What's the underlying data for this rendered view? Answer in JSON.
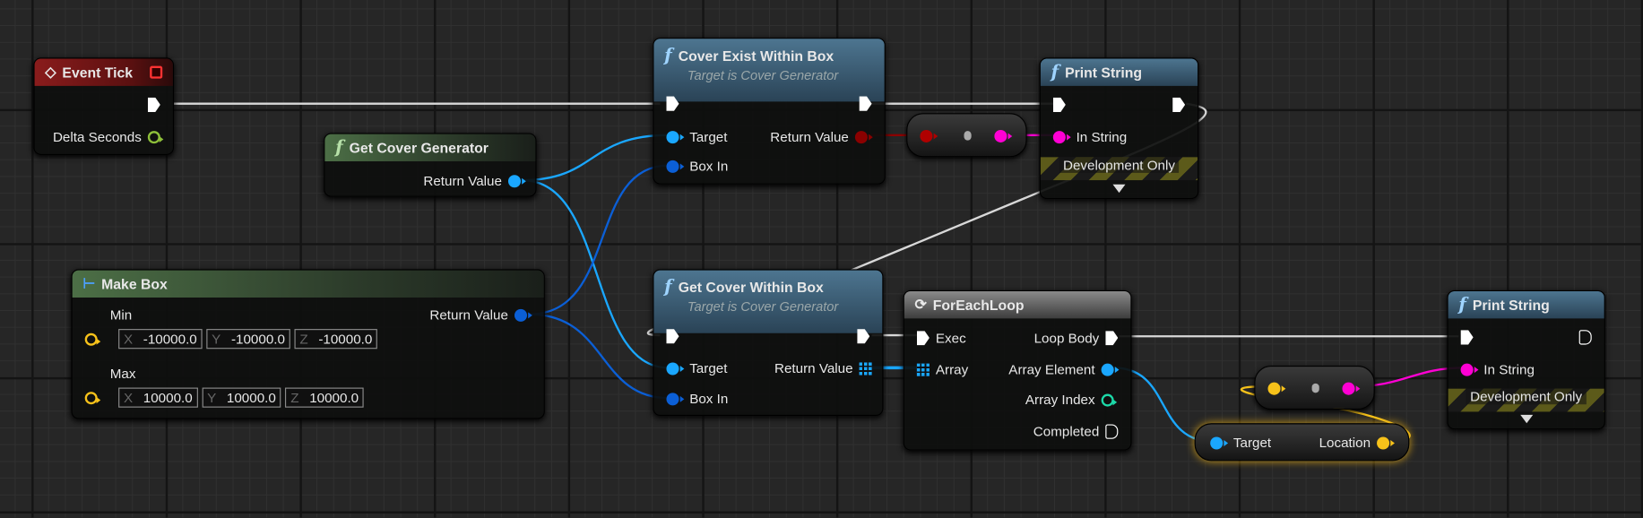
{
  "colors": {
    "exec": "#ffffff",
    "object": "#1aa7ff",
    "struct_box": "#0b5fd6",
    "bool": "#8b0000",
    "string": "#ff00d4",
    "vector": "#f7c21a",
    "float": "#8ec03a",
    "int": "#1cd9a8"
  },
  "event_tick": {
    "title": "Event Tick",
    "delta": "Delta Seconds",
    "icon": "event-diamond-icon"
  },
  "get_cover_generator": {
    "title": "Get Cover Generator",
    "return": "Return Value"
  },
  "make_box": {
    "title": "Make Box",
    "min": "Min",
    "max": "Max",
    "return": "Return Value",
    "min_values": [
      {
        "axis": "X",
        "value": "-10000.0"
      },
      {
        "axis": "Y",
        "value": "-10000.0"
      },
      {
        "axis": "Z",
        "value": "-10000.0"
      }
    ],
    "max_values": [
      {
        "axis": "X",
        "value": "10000.0"
      },
      {
        "axis": "Y",
        "value": "10000.0"
      },
      {
        "axis": "Z",
        "value": "10000.0"
      }
    ]
  },
  "cover_exist": {
    "title": "Cover Exist Within Box",
    "subtitle": "Target is Cover Generator",
    "target": "Target",
    "box_in": "Box In",
    "return": "Return Value"
  },
  "get_cover_within": {
    "title": "Get Cover Within Box",
    "subtitle": "Target is Cover Generator",
    "target": "Target",
    "box_in": "Box In",
    "return": "Return Value"
  },
  "print_string_1": {
    "title": "Print String",
    "in_string": "In String",
    "dev_only": "Development Only"
  },
  "foreach": {
    "title": "ForEachLoop",
    "exec": "Exec",
    "array": "Array",
    "loop_body": "Loop Body",
    "element": "Array Element",
    "index": "Array Index",
    "completed": "Completed"
  },
  "get_location": {
    "target": "Target",
    "location": "Location"
  },
  "print_string_2": {
    "title": "Print String",
    "in_string": "In String",
    "dev_only": "Development Only"
  }
}
